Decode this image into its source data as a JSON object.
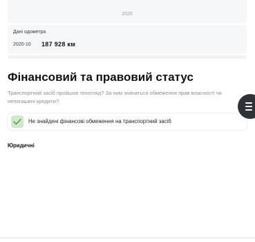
{
  "chart": {
    "year_label": "2020"
  },
  "odometer": {
    "title": "Дані одометра",
    "date": "2020-10",
    "value": "187 928 км"
  },
  "status_section": {
    "title": "Фінансовий та правовий статус",
    "description": "Транспортний засіб пройшов техогляд? За ним значаться обмеження прав власності чи непогашені кредити?",
    "item_text": "Не знайдені фінансові обмеження на транспортний засіб",
    "item_icon": "check-icon",
    "item_accent": "#cde9c9",
    "subheading": "Юридичні"
  },
  "menu_button": {
    "icon": "menu-icon"
  }
}
